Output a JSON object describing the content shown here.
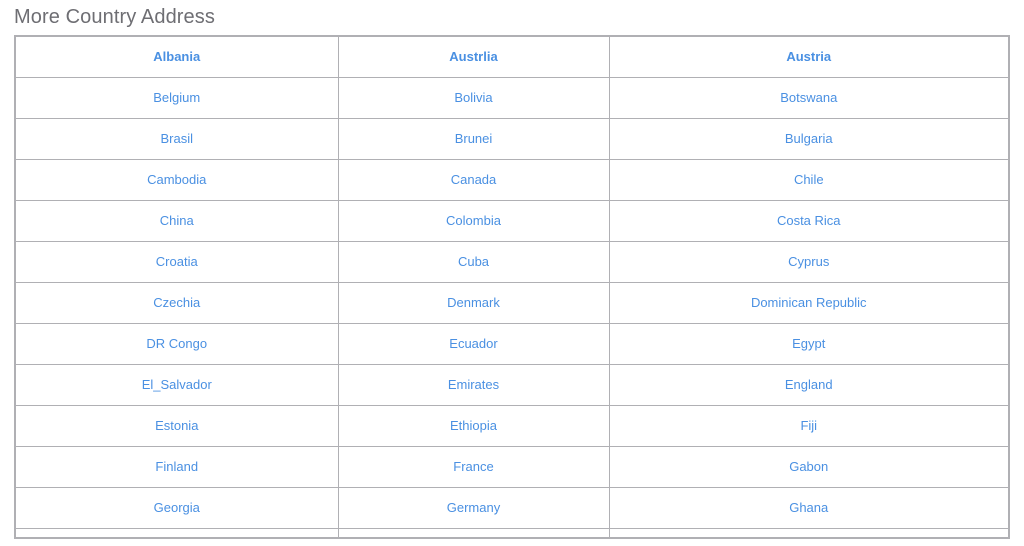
{
  "page": {
    "title": "More Country Address",
    "link_color": "#4a90e2",
    "title_color": "#6e6e73",
    "border_color": "#b0b0b4",
    "background_color": "#ffffff"
  },
  "table": {
    "columns": 3,
    "rows": [
      {
        "bold": true,
        "cells": [
          "Albania",
          "Austrlia",
          "Austria"
        ]
      },
      {
        "bold": false,
        "cells": [
          "Belgium",
          "Bolivia",
          "Botswana"
        ]
      },
      {
        "bold": false,
        "cells": [
          "Brasil",
          "Brunei",
          "Bulgaria"
        ]
      },
      {
        "bold": false,
        "cells": [
          "Cambodia",
          "Canada",
          "Chile"
        ]
      },
      {
        "bold": false,
        "cells": [
          "China",
          "Colombia",
          "Costa Rica"
        ]
      },
      {
        "bold": false,
        "cells": [
          "Croatia",
          "Cuba",
          "Cyprus"
        ]
      },
      {
        "bold": false,
        "cells": [
          "Czechia",
          "Denmark",
          "Dominican Republic"
        ]
      },
      {
        "bold": false,
        "cells": [
          "DR Congo",
          "Ecuador",
          "Egypt"
        ]
      },
      {
        "bold": false,
        "cells": [
          "El_Salvador",
          "Emirates",
          "England"
        ]
      },
      {
        "bold": false,
        "cells": [
          "Estonia",
          "Ethiopia",
          "Fiji"
        ]
      },
      {
        "bold": false,
        "cells": [
          "Finland",
          "France",
          "Gabon"
        ]
      },
      {
        "bold": false,
        "cells": [
          "Georgia",
          "Germany",
          "Ghana"
        ]
      },
      {
        "bold": false,
        "partial": true,
        "cells": [
          "",
          "",
          ""
        ]
      }
    ]
  }
}
